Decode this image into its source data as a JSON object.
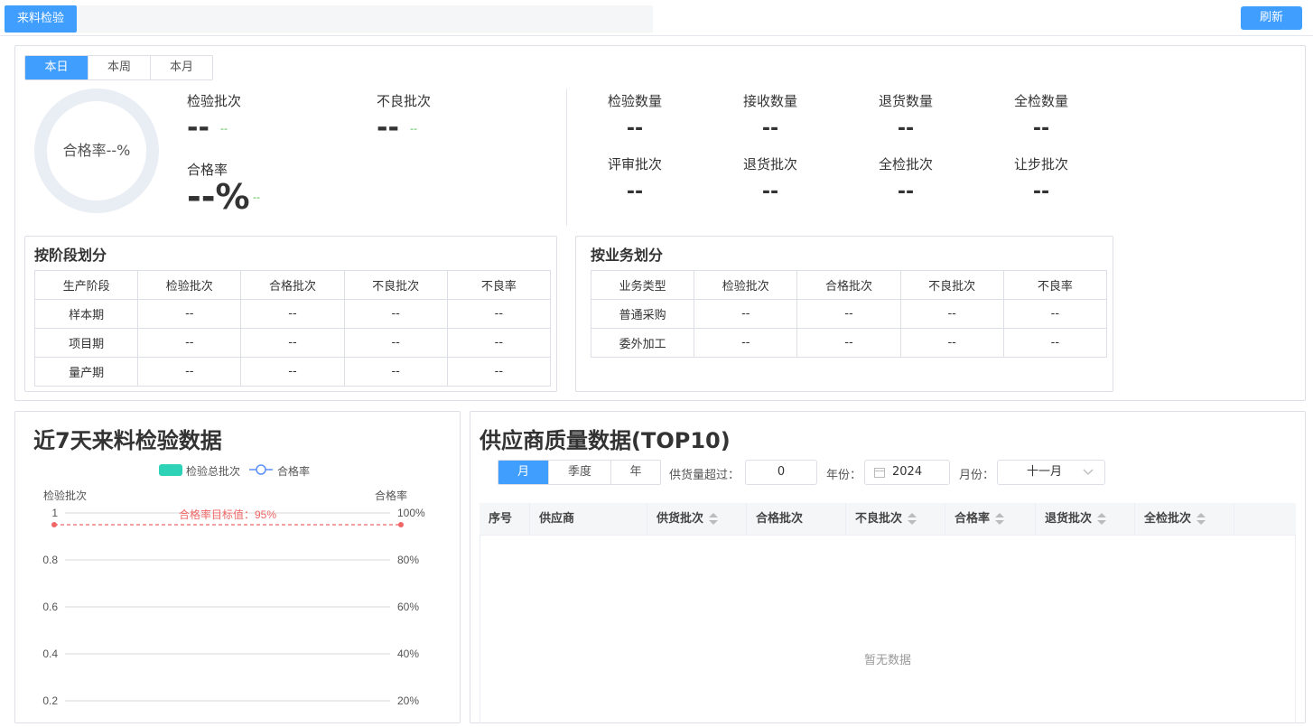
{
  "topbar": {
    "tab_label": "来料检验",
    "refresh_label": "刷新"
  },
  "summary": {
    "period_tabs": [
      "本日",
      "本周",
      "本月"
    ],
    "donut_label": "合格率--%",
    "inspect_batch": {
      "label": "检验批次",
      "value": "--",
      "delta": "--"
    },
    "bad_batch": {
      "label": "不良批次",
      "value": "--",
      "delta": "--"
    },
    "pass_rate": {
      "label": "合格率",
      "value": "--%",
      "delta": "--"
    },
    "quantities": [
      {
        "label": "检验数量",
        "value": "--"
      },
      {
        "label": "接收数量",
        "value": "--"
      },
      {
        "label": "退货数量",
        "value": "--"
      },
      {
        "label": "全检数量",
        "value": "--"
      },
      {
        "label": "评审批次",
        "value": "--"
      },
      {
        "label": "退货批次",
        "value": "--"
      },
      {
        "label": "全检批次",
        "value": "--"
      },
      {
        "label": "让步批次",
        "value": "--"
      }
    ]
  },
  "stage_table": {
    "title": "按阶段划分",
    "headers": [
      "生产阶段",
      "检验批次",
      "合格批次",
      "不良批次",
      "不良率"
    ],
    "rows": [
      [
        "样本期",
        "--",
        "--",
        "--",
        "--"
      ],
      [
        "项目期",
        "--",
        "--",
        "--",
        "--"
      ],
      [
        "量产期",
        "--",
        "--",
        "--",
        "--"
      ]
    ]
  },
  "business_table": {
    "title": "按业务划分",
    "headers": [
      "业务类型",
      "检验批次",
      "合格批次",
      "不良批次",
      "不良率"
    ],
    "rows": [
      [
        "普通采购",
        "--",
        "--",
        "--",
        "--"
      ],
      [
        "委外加工",
        "--",
        "--",
        "--",
        "--"
      ]
    ]
  },
  "chart_data": {
    "type": "bar",
    "title": "近7天来料检验数据",
    "legend": [
      "检验总批次",
      "合格率"
    ],
    "ylabel": "检验批次",
    "y2label": "合格率",
    "y_ticks": [
      "1",
      "0.8",
      "0.6",
      "0.4",
      "0.2"
    ],
    "y2_ticks": [
      "100%",
      "80%",
      "60%",
      "40%",
      "20%"
    ],
    "ylim": [
      0,
      1
    ],
    "y2lim": [
      0,
      100
    ],
    "target_line": {
      "label": "合格率目标值：95%",
      "value": 95
    },
    "series": [],
    "colors": {
      "bar": "#2ed3b7",
      "line": "#5b8ff9",
      "target": "#ee6666"
    },
    "grid": true,
    "legend_position": "top-center"
  },
  "supplier": {
    "title": "供应商质量数据(TOP10)",
    "period_tabs": [
      "月",
      "季度",
      "年"
    ],
    "supply_label": "供货量超过：",
    "supply_value": "0",
    "year_label": "年份：",
    "year_value": "2024",
    "month_label": "月份：",
    "month_value": "十一月",
    "columns": [
      "序号",
      "供应商",
      "供货批次",
      "合格批次",
      "不良批次",
      "合格率",
      "退货批次",
      "全检批次"
    ],
    "empty_text": "暂无数据"
  }
}
